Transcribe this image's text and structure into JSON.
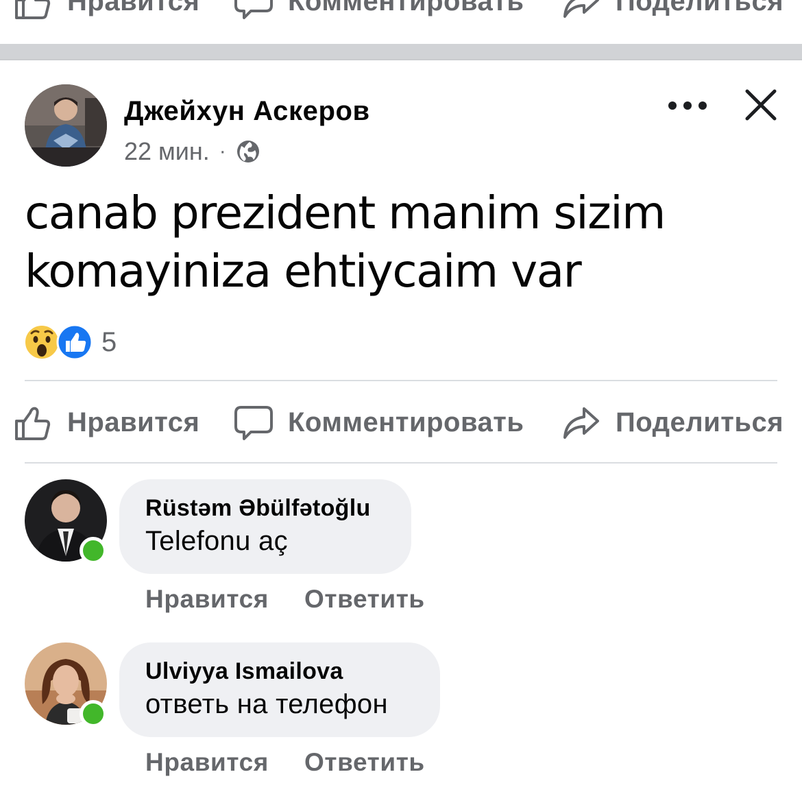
{
  "prev_post_actions": {
    "like": "Нравится",
    "comment": "Комментировать",
    "share": "Поделиться"
  },
  "post": {
    "author": "Джейхун Аскеров",
    "time": "22 мин.",
    "separator": "·",
    "privacy_icon": "globe-icon",
    "text_line1": "canab prezident manim sizim",
    "text_line2": "komayiniza ehtiycaim var",
    "reaction_icons": [
      "wow-reaction-icon",
      "like-reaction-icon"
    ],
    "reaction_count": "5",
    "actions": {
      "like": "Нравится",
      "comment": "Комментировать",
      "share": "Поделиться"
    }
  },
  "comments": [
    {
      "name": "Rüstəm Əbülfətoğlu",
      "text": "Telefonu aç",
      "online": true,
      "like": "Нравится",
      "reply": "Ответить"
    },
    {
      "name": "Ulviyya Ismailova",
      "text": "ответь на телефон",
      "online": true,
      "like": "Нравится",
      "reply": "Ответить"
    }
  ],
  "colors": {
    "secondary_text": "#65676b",
    "primary_text": "#050505",
    "bubble": "#eff0f3",
    "online": "#42b72a",
    "like_blue": "#1877f2",
    "wow_yellow": "#f7c948",
    "divider": "#dadde1"
  }
}
